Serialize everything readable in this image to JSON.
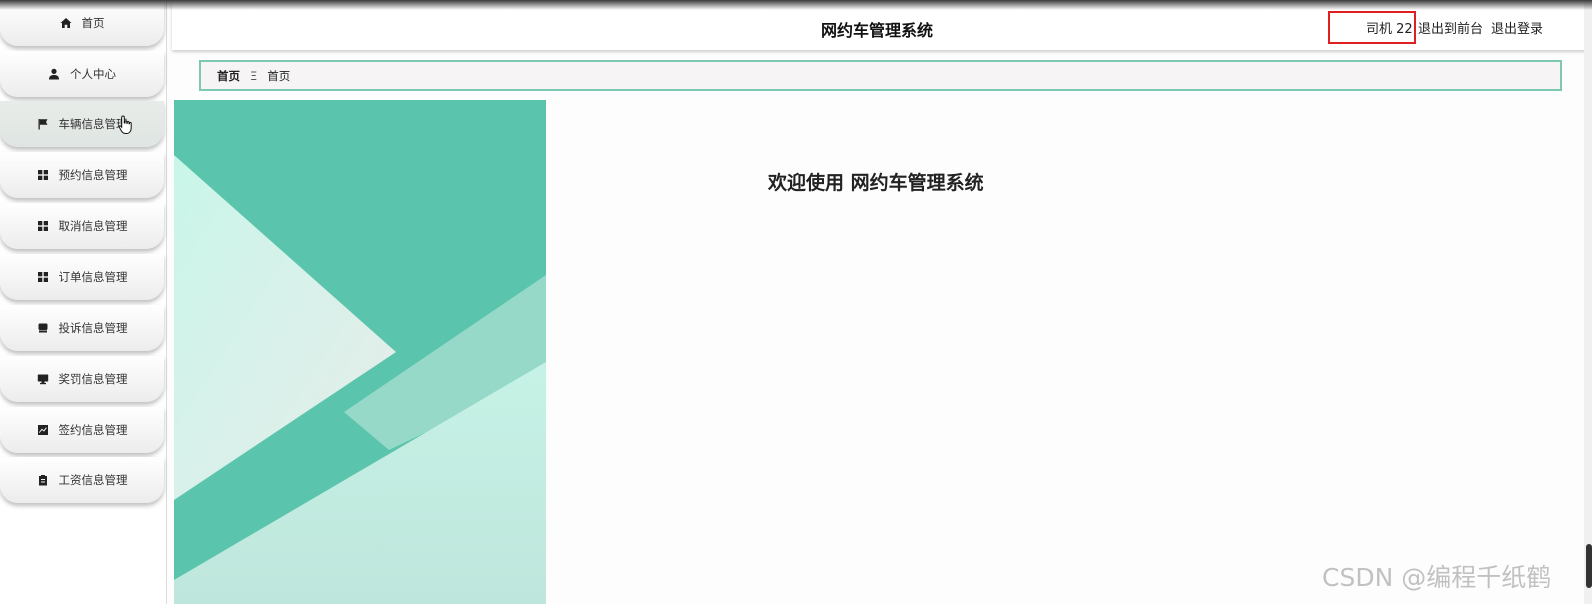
{
  "app": {
    "title": "网约车管理系统"
  },
  "header": {
    "user_name": "司机 22",
    "logout_front": "退出到前台",
    "logout": "退出登录"
  },
  "sidebar": {
    "items": [
      {
        "label": "首页",
        "icon": "home-icon"
      },
      {
        "label": "个人中心",
        "icon": "person-icon"
      },
      {
        "label": "车辆信息管理",
        "icon": "flag-icon"
      },
      {
        "label": "预约信息管理",
        "icon": "grid-icon"
      },
      {
        "label": "取消信息管理",
        "icon": "grid-icon"
      },
      {
        "label": "订单信息管理",
        "icon": "grid-icon"
      },
      {
        "label": "投诉信息管理",
        "icon": "chat-icon"
      },
      {
        "label": "奖罚信息管理",
        "icon": "monitor-icon"
      },
      {
        "label": "签约信息管理",
        "icon": "chart-icon"
      },
      {
        "label": "工资信息管理",
        "icon": "clipboard-icon"
      }
    ]
  },
  "breadcrumb": {
    "home": "首页",
    "separator": "Ξ",
    "current": "首页"
  },
  "main": {
    "welcome": "欢迎使用 网约车管理系统"
  },
  "watermark": "CSDN @编程千纸鹤",
  "colors": {
    "accent": "#5bc4ac",
    "breadcrumb_border": "#7cc8b3",
    "highlight_box": "#e02020"
  }
}
